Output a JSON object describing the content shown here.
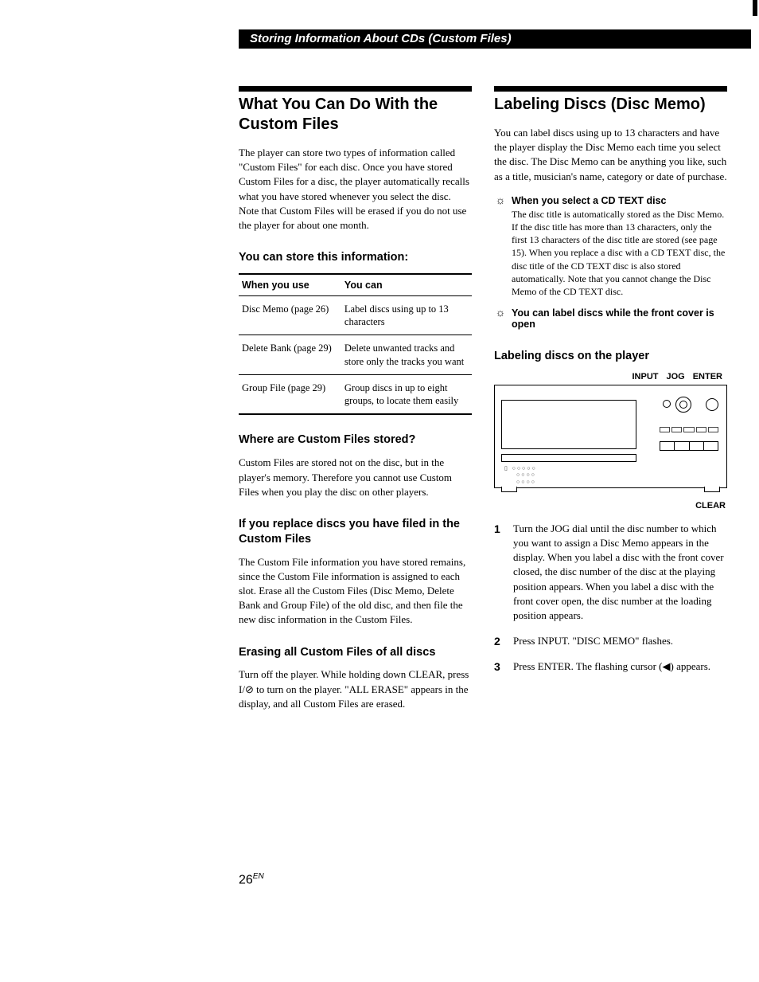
{
  "header": "Storing Information About CDs (Custom Files)",
  "left": {
    "h1": "What You Can Do With the Custom Files",
    "intro": "The player can store two types of information called \"Custom Files\" for each disc. Once you have stored Custom Files for a disc, the player automatically recalls what you have stored whenever you select the disc. Note that Custom Files will be erased if you do not use the player for about one month.",
    "store_h": "You can store this information:",
    "table": {
      "h1": "When you use",
      "h2": "You can",
      "rows": [
        {
          "a": "Disc Memo (page 26)",
          "b": "Label discs using up to 13 characters"
        },
        {
          "a": "Delete Bank (page 29)",
          "b": "Delete unwanted tracks and store only the tracks you want"
        },
        {
          "a": "Group File (page 29)",
          "b": "Group discs in up to eight groups, to locate them easily"
        }
      ]
    },
    "where_h": "Where are Custom Files stored?",
    "where_p": "Custom Files are stored not on the disc, but in the player's memory. Therefore you cannot use Custom Files when you play the disc on other players.",
    "replace_h": "If you replace discs you have filed in the Custom Files",
    "replace_p": "The Custom File information you have stored remains, since the Custom File information is assigned to each slot. Erase all the Custom Files (Disc Memo, Delete Bank and Group File) of the old disc, and then file the new disc information in the Custom Files.",
    "erase_h": "Erasing all Custom Files of all discs",
    "erase_p": "Turn off the player. While holding down CLEAR, press I/⊘ to turn on the player. \"ALL ERASE\" appears in the display, and all Custom Files are erased."
  },
  "right": {
    "h1": "Labeling Discs (Disc Memo)",
    "intro": "You can label discs using up to 13 characters and have the player display the Disc Memo each time you select the disc. The Disc Memo can be anything you like, such as a title, musician's name, category or date of purchase.",
    "tip1_t": "When you select a CD TEXT disc",
    "tip1_p": "The disc title is automatically stored as the Disc Memo. If the disc title has more than 13 characters, only the first 13 characters of the disc title are stored (see page 15). When you replace a disc with a CD TEXT disc, the disc title of the CD TEXT disc is also stored automatically. Note that you cannot change the Disc Memo of the CD TEXT disc.",
    "tip2_t": "You can label discs while the front cover is open",
    "label_h": "Labeling discs on the player",
    "dlabels": {
      "a": "INPUT",
      "b": "JOG",
      "c": "ENTER"
    },
    "clear": "CLEAR",
    "steps": [
      "Turn the JOG dial until the disc number to which you want to assign a Disc Memo appears in the display.\nWhen you label a disc with the front cover closed, the disc number of the disc at the playing position appears.\nWhen you label a disc with the front cover open, the disc number at the loading position appears.",
      "Press INPUT.\n\"DISC MEMO\" flashes.",
      "Press ENTER.\nThe flashing cursor (◀) appears."
    ]
  },
  "page": {
    "num": "26",
    "suf": "EN"
  }
}
